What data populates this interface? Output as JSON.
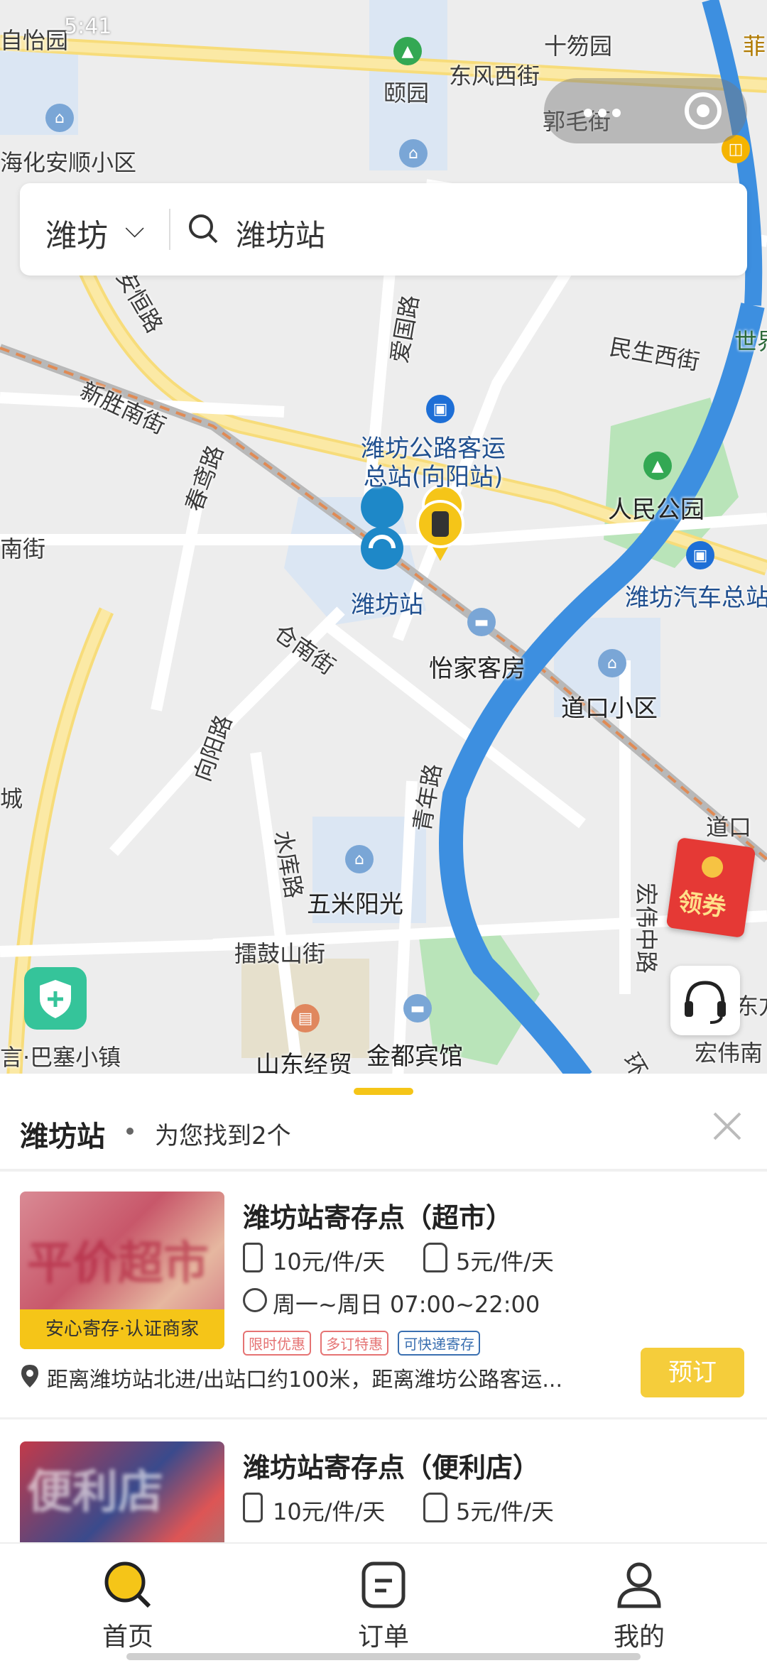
{
  "statusbar": {
    "time": "5:41"
  },
  "map": {
    "labels": {
      "yiyuan": "自怡园",
      "yiyuan2": "颐园",
      "shifenyuan": "十笏园",
      "fei": "菲",
      "dongfeng": "东风西街",
      "guomao": "郭毛街",
      "haihua": "海化安顺小区",
      "anheng": "安恒路",
      "aiguo": "爱国路",
      "minsheng": "民生西街",
      "shijie": "世界",
      "xinsheng": "新胜南街",
      "chunyuan": "春鸢路",
      "busstation": "潍坊公路客运\n总站(向阳站)",
      "renmin": "人民公园",
      "weifangbus": "潍坊汽车总站",
      "nanjie": "南街",
      "weifangstation": "潍坊站",
      "cangnan": "仓南街",
      "yijia": "怡家客房",
      "daokou": "道口小区",
      "xiangyang": "向阳路",
      "qingnian": "青年路",
      "cheng": "城",
      "shuiku": "水库路",
      "wumi": "五米阳光",
      "hongwei": "宏伟中路",
      "daokou2": "道口",
      "leigu": "擂鼓山街",
      "dongfang": "东方",
      "hongweinan": "宏伟南",
      "basai": "言·巴塞小镇",
      "shandong": "山东经贸",
      "jindu": "金都宾馆",
      "huan": "环"
    },
    "coupon_label": "领券"
  },
  "search": {
    "city": "潍坊",
    "query": "潍坊站"
  },
  "sheet": {
    "title": "潍坊站",
    "count_text": "为您找到2个",
    "results": [
      {
        "name": "潍坊站寄存点（超市）",
        "price_luggage": "10元/件/天",
        "price_bag": "5元/件/天",
        "hours": "周一~周日 07:00~22:00",
        "badge": "安心寄存·认证商家",
        "thumb_text": "平价超市",
        "tags": [
          "限时优惠",
          "多订特惠",
          "可快递寄存"
        ],
        "address": "距离潍坊站北进/出站口约100米，距离潍坊公路客运...",
        "book_label": "预订"
      },
      {
        "name": "潍坊站寄存点（便利店）",
        "price_luggage": "10元/件/天",
        "price_bag": "5元/件/天",
        "thumb_text": "便利店"
      }
    ]
  },
  "tabbar": {
    "tabs": [
      {
        "label": "首页",
        "icon": "search-icon"
      },
      {
        "label": "订单",
        "icon": "order-icon"
      },
      {
        "label": "我的",
        "icon": "user-icon"
      }
    ]
  },
  "colors": {
    "accent": "#f5c518",
    "book": "#f5cd3b",
    "station_pin": "#1e88c8",
    "river": "#3d8fe0",
    "park": "#b9e4b9"
  }
}
